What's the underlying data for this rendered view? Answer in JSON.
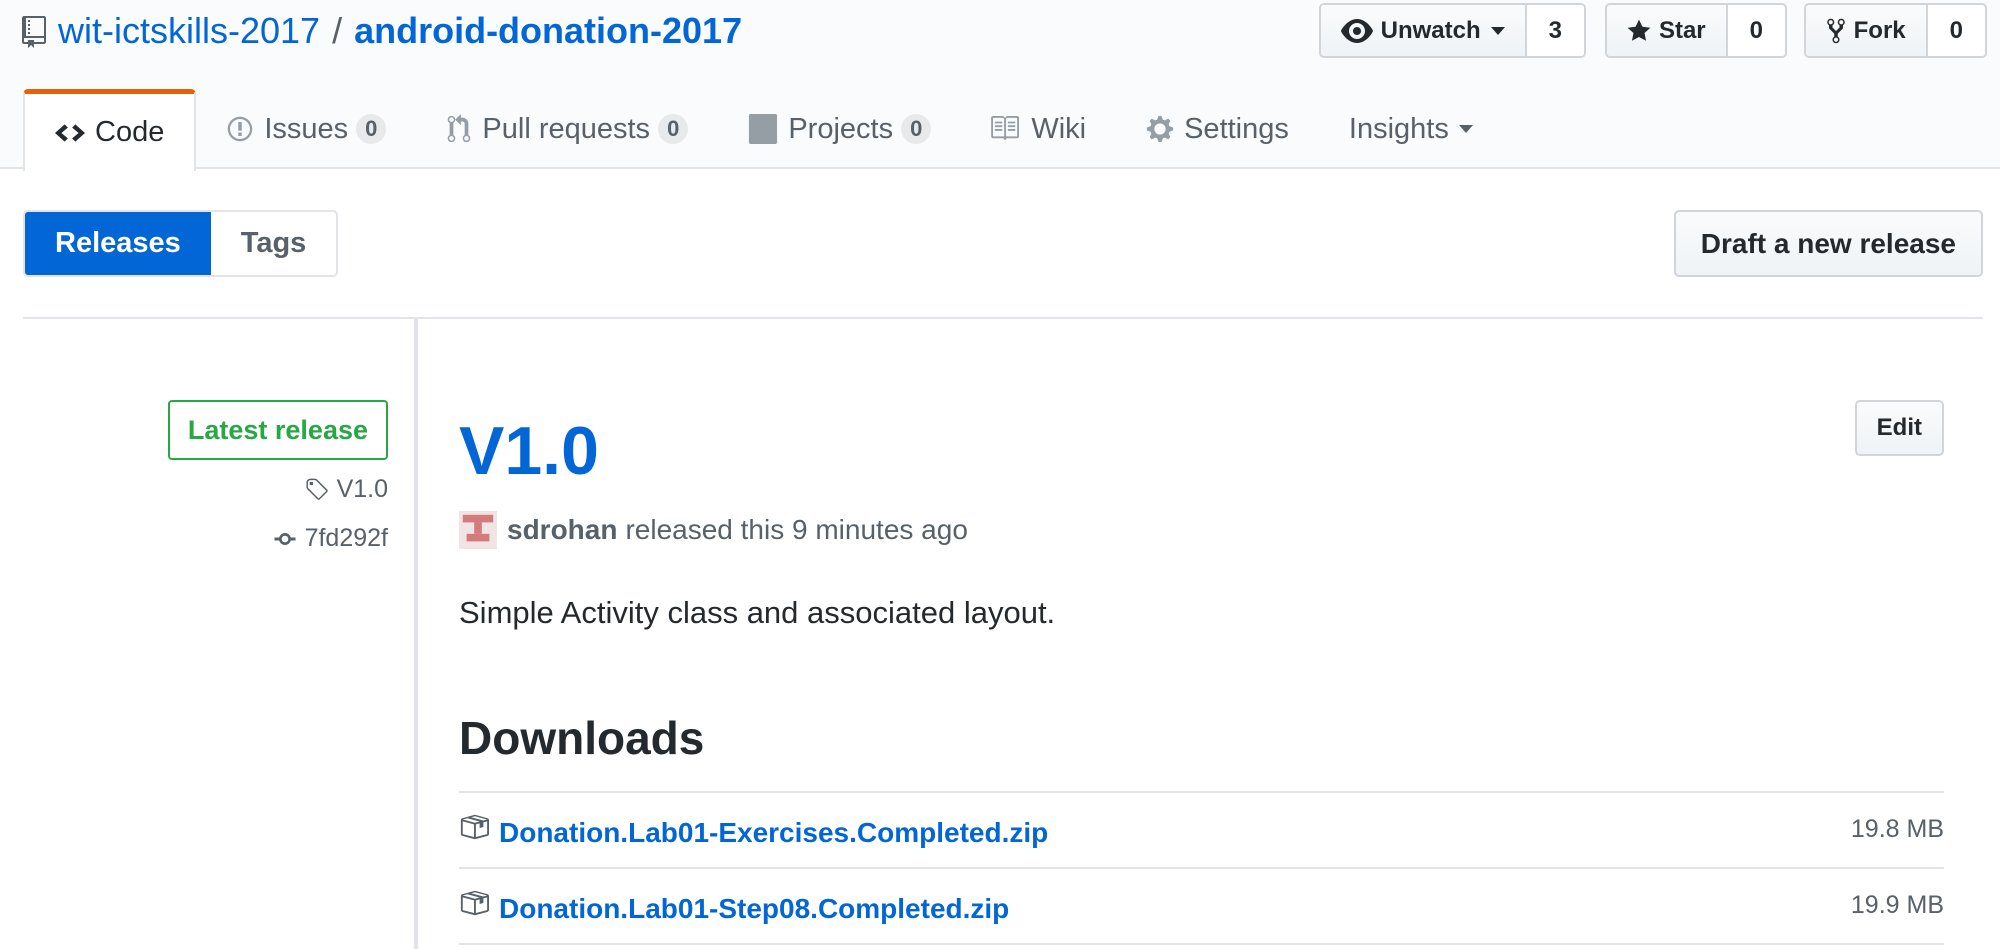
{
  "repo": {
    "owner": "wit-ictskills-2017",
    "separator": "/",
    "name": "android-donation-2017"
  },
  "actions": {
    "watch": {
      "label": "Unwatch",
      "count": "3"
    },
    "star": {
      "label": "Star",
      "count": "0"
    },
    "fork": {
      "label": "Fork",
      "count": "0"
    }
  },
  "nav": {
    "code": "Code",
    "issues": {
      "label": "Issues",
      "count": "0"
    },
    "pulls": {
      "label": "Pull requests",
      "count": "0"
    },
    "projects": {
      "label": "Projects",
      "count": "0"
    },
    "wiki": "Wiki",
    "settings": "Settings",
    "insights": "Insights"
  },
  "subnav": {
    "releases": "Releases",
    "tags": "Tags",
    "draft_button": "Draft a new release"
  },
  "release": {
    "badge": "Latest release",
    "tag": "V1.0",
    "commit": "7fd292f",
    "title": "V1.0",
    "edit_button": "Edit",
    "author": "sdrohan",
    "released_text": "released this 9 minutes ago",
    "description": "Simple Activity class and associated layout.",
    "downloads_heading": "Downloads",
    "downloads": [
      {
        "name": "Donation.Lab01-Exercises.Completed.zip",
        "size": "19.8 MB"
      },
      {
        "name": "Donation.Lab01-Step08.Completed.zip",
        "size": "19.9 MB"
      }
    ]
  },
  "colors": {
    "link": "#0366d6",
    "active_tab_border": "#e36209",
    "latest_green": "#28a745",
    "selected_subnav": "#0366d6"
  }
}
